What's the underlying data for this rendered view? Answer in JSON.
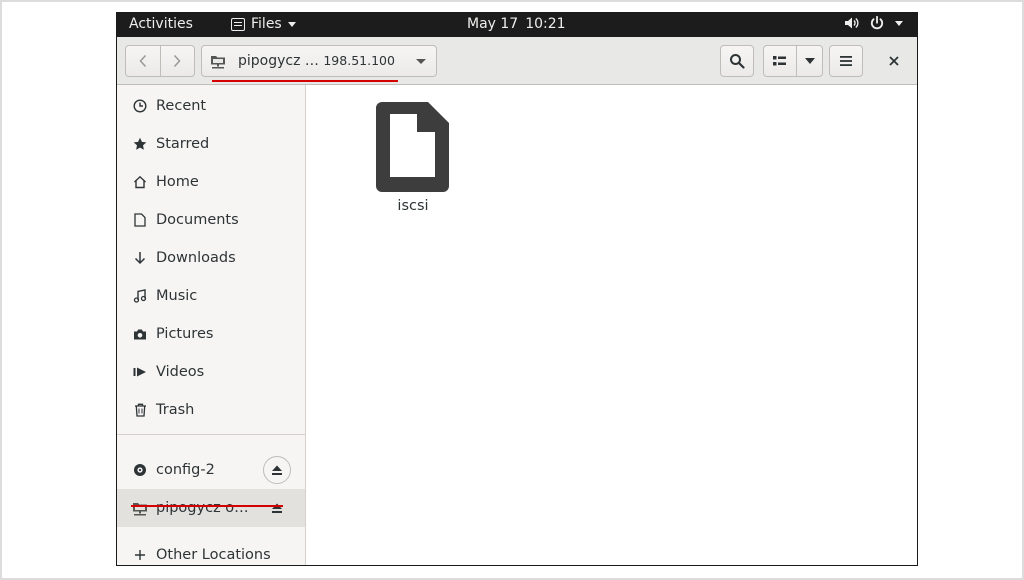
{
  "topbar": {
    "activities": "Activities",
    "app_name": "Files",
    "date": "May 17",
    "time": "10:21"
  },
  "headerbar": {
    "path_name": "pipogycz …",
    "path_ip": "198.51.100"
  },
  "sidebar": {
    "places": [
      {
        "label": "Recent",
        "icon": "clock-icon"
      },
      {
        "label": "Starred",
        "icon": "star-icon"
      },
      {
        "label": "Home",
        "icon": "home-icon"
      },
      {
        "label": "Documents",
        "icon": "document-icon"
      },
      {
        "label": "Downloads",
        "icon": "download-icon"
      },
      {
        "label": "Music",
        "icon": "music-icon"
      },
      {
        "label": "Pictures",
        "icon": "camera-icon"
      },
      {
        "label": "Videos",
        "icon": "video-icon"
      },
      {
        "label": "Trash",
        "icon": "trash-icon"
      }
    ],
    "devices": [
      {
        "label": "config-2",
        "icon": "disc-icon"
      },
      {
        "label": "pipogycz o…",
        "icon": "network-folder-icon"
      }
    ],
    "other_locations": "Other Locations"
  },
  "content": {
    "files": [
      {
        "name": "iscsi",
        "icon": "generic-file-icon"
      }
    ]
  },
  "colors": {
    "topbar_bg": "#1c1c1c",
    "headerbar_bg": "#e8e8e7",
    "sidebar_bg": "#f6f5f4",
    "highlight_underline": "#d40000",
    "file_icon": "#3d3d3d"
  }
}
